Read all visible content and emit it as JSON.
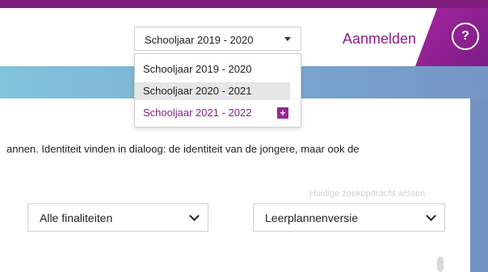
{
  "header": {
    "year_select": {
      "current": "Schooljaar 2019 - 2020",
      "options": [
        "Schooljaar 2019 - 2020",
        "Schooljaar 2020 - 2021",
        "Schooljaar 2021 - 2022"
      ],
      "new_badge": "+"
    },
    "login": "Aanmelden",
    "help": "?"
  },
  "main": {
    "text": "annen. Identiteit vinden in dialoog: de identiteit van de jongere, maar ook de",
    "reset_search": "Huidige zoekopdracht wissen.",
    "filters": {
      "finaliteit": "Alle finaliteiten",
      "versie": "Leerplannenversie"
    }
  },
  "colors": {
    "brand": "#8a1f88",
    "band": "#7aa6cf"
  }
}
